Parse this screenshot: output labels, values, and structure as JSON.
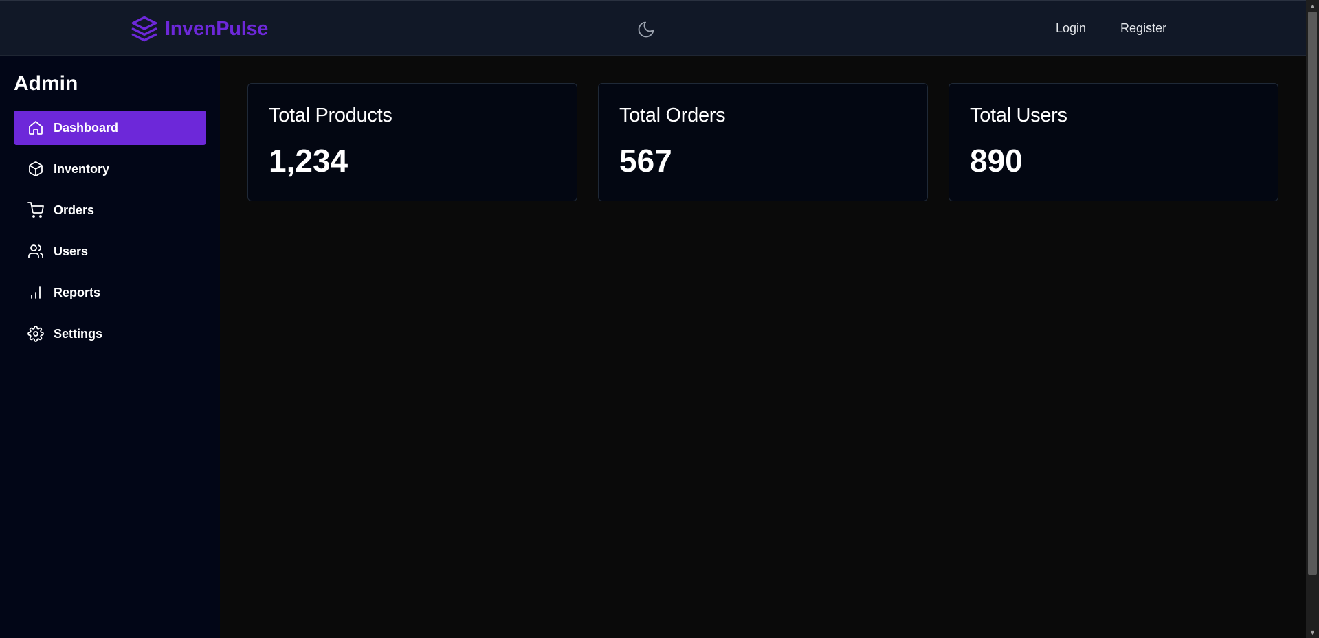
{
  "header": {
    "brand_name": "InvenPulse",
    "brand_icon": "layers-icon",
    "theme_icon": "moon-icon",
    "links": [
      {
        "label": "Login"
      },
      {
        "label": "Register"
      }
    ]
  },
  "sidebar": {
    "title": "Admin",
    "items": [
      {
        "label": "Dashboard",
        "icon": "home-icon",
        "active": true
      },
      {
        "label": "Inventory",
        "icon": "box-icon",
        "active": false
      },
      {
        "label": "Orders",
        "icon": "cart-icon",
        "active": false
      },
      {
        "label": "Users",
        "icon": "users-icon",
        "active": false
      },
      {
        "label": "Reports",
        "icon": "bar-chart-icon",
        "active": false
      },
      {
        "label": "Settings",
        "icon": "gear-icon",
        "active": false
      }
    ]
  },
  "stats": [
    {
      "label": "Total Products",
      "value": "1,234"
    },
    {
      "label": "Total Orders",
      "value": "567"
    },
    {
      "label": "Total Users",
      "value": "890"
    }
  ],
  "colors": {
    "accent": "#6d28d9",
    "header_bg": "#111827",
    "sidebar_bg": "#020617",
    "content_bg": "#0a0a0a",
    "card_bg": "#030712"
  }
}
